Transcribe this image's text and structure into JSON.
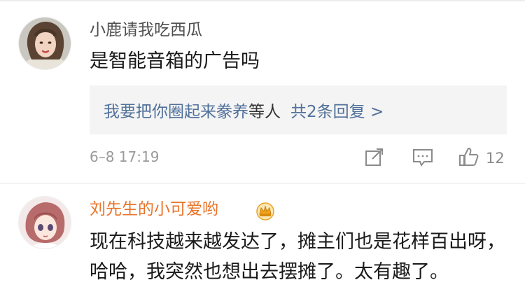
{
  "comments": [
    {
      "username": "小鹿请我吃西瓜",
      "text": "是智能音箱的广告吗",
      "replies_preview": {
        "replier": "我要把你圈起来豢养",
        "suffix": "等人",
        "count_text": "共2条回复 >"
      },
      "timestamp": "6–8 17:19",
      "likes": "12",
      "icons": [
        "share-icon",
        "comment-icon",
        "like-icon"
      ]
    },
    {
      "username": "刘先生的小可爱哟",
      "text": "现在科技越来越发达了，摊主们也是花样百出呀，哈哈，我突然也想出去摆摊了。太有趣了。",
      "badge": "crown-badge-icon"
    }
  ],
  "colors": {
    "username_default": "#4e4e4e",
    "username_vip": "#e8742a",
    "link": "#50709a",
    "meta": "#9a9a9a",
    "reply_bg": "#f4f4f4"
  }
}
